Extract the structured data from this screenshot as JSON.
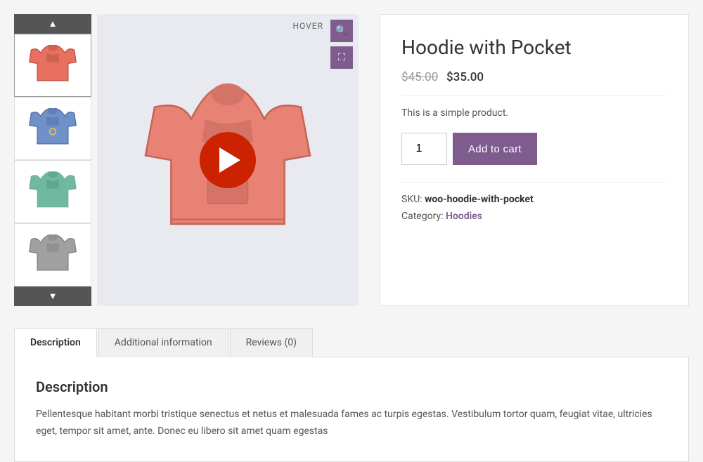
{
  "product": {
    "title": "Hoodie with Pocket",
    "old_price": "$45.00",
    "new_price": "$35.00",
    "description": "This is a simple product.",
    "sku": "woo-hoodie-with-pocket",
    "category": "Hoodies",
    "quantity": "1"
  },
  "gallery": {
    "hover_label": "HOVER",
    "zoom_icon": "🔍",
    "expand_icon": "⛶",
    "thumbnails": [
      {
        "id": "thumb-1",
        "color": "red"
      },
      {
        "id": "thumb-2",
        "color": "blue"
      },
      {
        "id": "thumb-3",
        "color": "teal"
      },
      {
        "id": "thumb-4",
        "color": "gray"
      }
    ]
  },
  "buttons": {
    "add_to_cart": "Add to cart",
    "up_nav": "▲",
    "down_nav": "▼"
  },
  "tabs": {
    "items": [
      {
        "id": "description",
        "label": "Description",
        "active": true
      },
      {
        "id": "additional-information",
        "label": "Additional information",
        "active": false
      },
      {
        "id": "reviews",
        "label": "Reviews (0)",
        "active": false
      }
    ],
    "active_tab_title": "Description",
    "active_tab_content": "Pellentesque habitant morbi tristique senectus et netus et malesuada fames ac turpis egestas. Vestibulum tortor quam, feugiat vitae, ultricies eget, tempor sit amet, ante. Donec eu libero sit amet quam egestas"
  },
  "meta": {
    "sku_label": "SKU:",
    "category_label": "Category:"
  }
}
